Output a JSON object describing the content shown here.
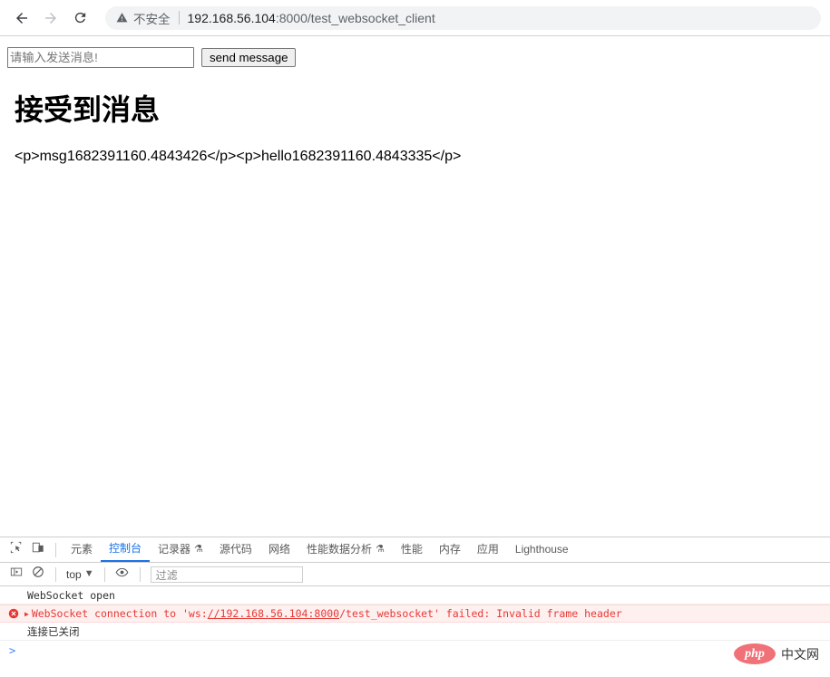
{
  "browser": {
    "back_icon": "back-arrow-icon",
    "forward_icon": "forward-arrow-icon",
    "reload_icon": "reload-icon",
    "security_icon": "warning-triangle-icon",
    "security_label": "不安全",
    "url_host": "192.168.56.104",
    "url_rest": ":8000/test_websocket_client",
    "url_full": "192.168.56.104:8000/test_websocket_client"
  },
  "page": {
    "input_placeholder": "请输入发送消息!",
    "input_value": "",
    "send_button": "send message",
    "heading": "接受到消息",
    "received_message": "<p>msg1682391160.4843426</p><p>hello1682391160.4843335</p>"
  },
  "devtools": {
    "inspect_icon": "inspect-element-icon",
    "device_icon": "device-toolbar-icon",
    "tabs": [
      {
        "label": "元素",
        "active": false,
        "flask": false
      },
      {
        "label": "控制台",
        "active": true,
        "flask": false
      },
      {
        "label": "记录器",
        "active": false,
        "flask": true
      },
      {
        "label": "源代码",
        "active": false,
        "flask": false
      },
      {
        "label": "网络",
        "active": false,
        "flask": false
      },
      {
        "label": "性能数据分析",
        "active": false,
        "flask": true
      },
      {
        "label": "性能",
        "active": false,
        "flask": false
      },
      {
        "label": "内存",
        "active": false,
        "flask": false
      },
      {
        "label": "应用",
        "active": false,
        "flask": false
      },
      {
        "label": "Lighthouse",
        "active": false,
        "flask": false
      }
    ],
    "toolbar": {
      "sidebar_icon": "console-sidebar-icon",
      "clear_icon": "clear-console-icon",
      "context_label": "top",
      "context_caret": "▼",
      "eye_icon": "live-expression-eye-icon",
      "filter_placeholder": "过滤"
    },
    "console": {
      "log1": "WebSocket open",
      "error_prefix": "WebSocket connection to 'ws:",
      "error_url": "//192.168.56.104:8000",
      "error_suffix": "/test_websocket' failed: Invalid frame header",
      "log2": "连接已关闭",
      "prompt": ">"
    }
  },
  "watermark": {
    "logo_text": "php",
    "label": "中文网"
  },
  "colors": {
    "accent": "#1a73e8",
    "error": "#e53935",
    "error_bg": "#fff0f0",
    "chrome_bg": "#f1f3f4",
    "watermark_pink": "#f07178"
  }
}
